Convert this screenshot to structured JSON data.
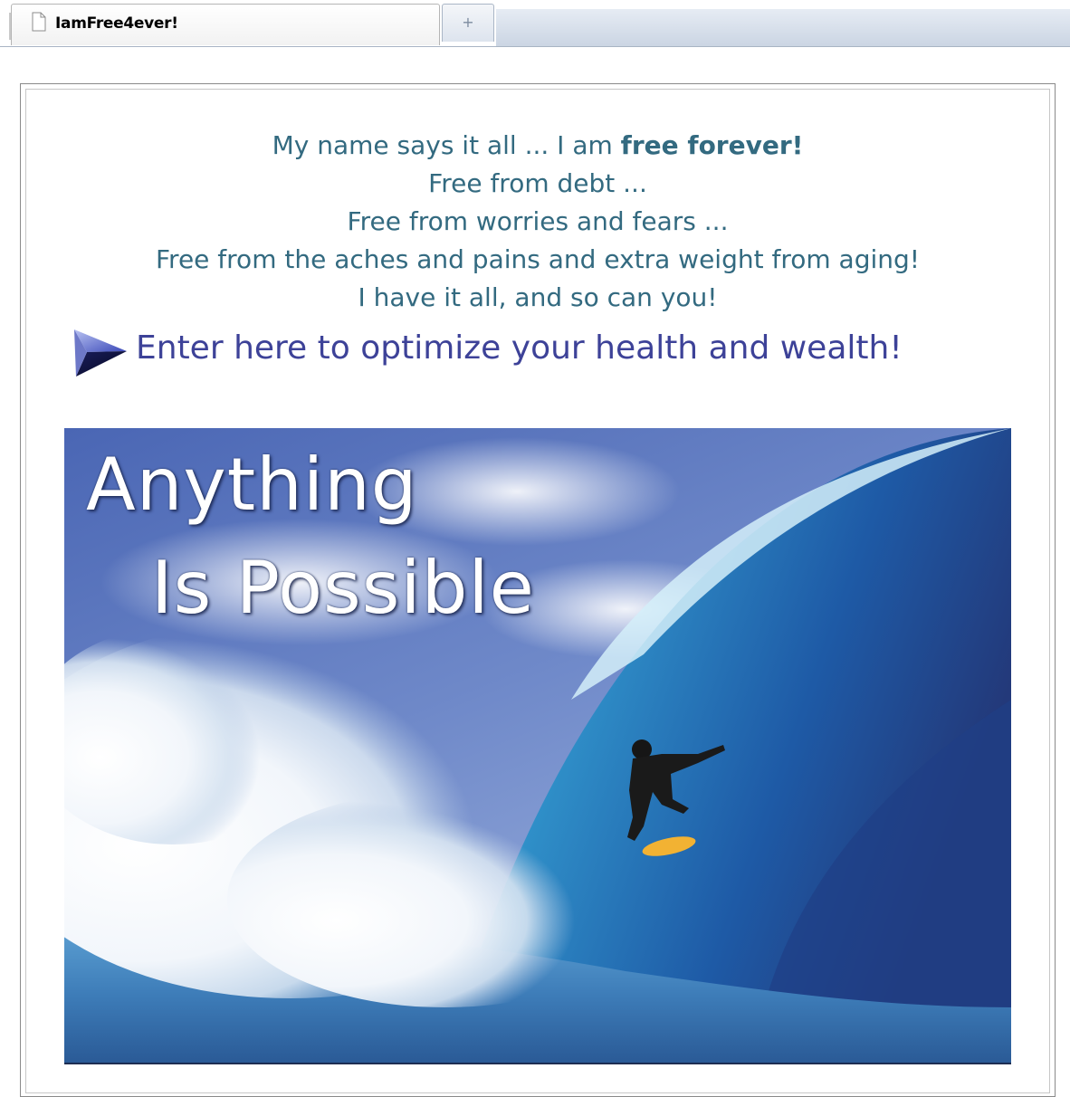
{
  "browser": {
    "tab_title": "IamFree4ever!",
    "new_tab_symbol": "+",
    "tab_icon": "document-icon"
  },
  "intro": {
    "line1_start": "My name says it all ... I am ",
    "line1_bold": "free forever!",
    "line2": "Free from debt ...",
    "line3": "Free from worries and fears ...",
    "line4": "Free from the aches and pains and extra weight from aging!",
    "line5": "I have it all, and so can you!"
  },
  "enter": {
    "link_text": "Enter here to optimize your health and wealth!",
    "icon": "arrow-right-icon"
  },
  "hero": {
    "line1": "Anything",
    "line2": "Is Possible"
  },
  "colors": {
    "intro_text": "#336a80",
    "link_text": "#3d4298",
    "hero_text": "#ffffff"
  }
}
